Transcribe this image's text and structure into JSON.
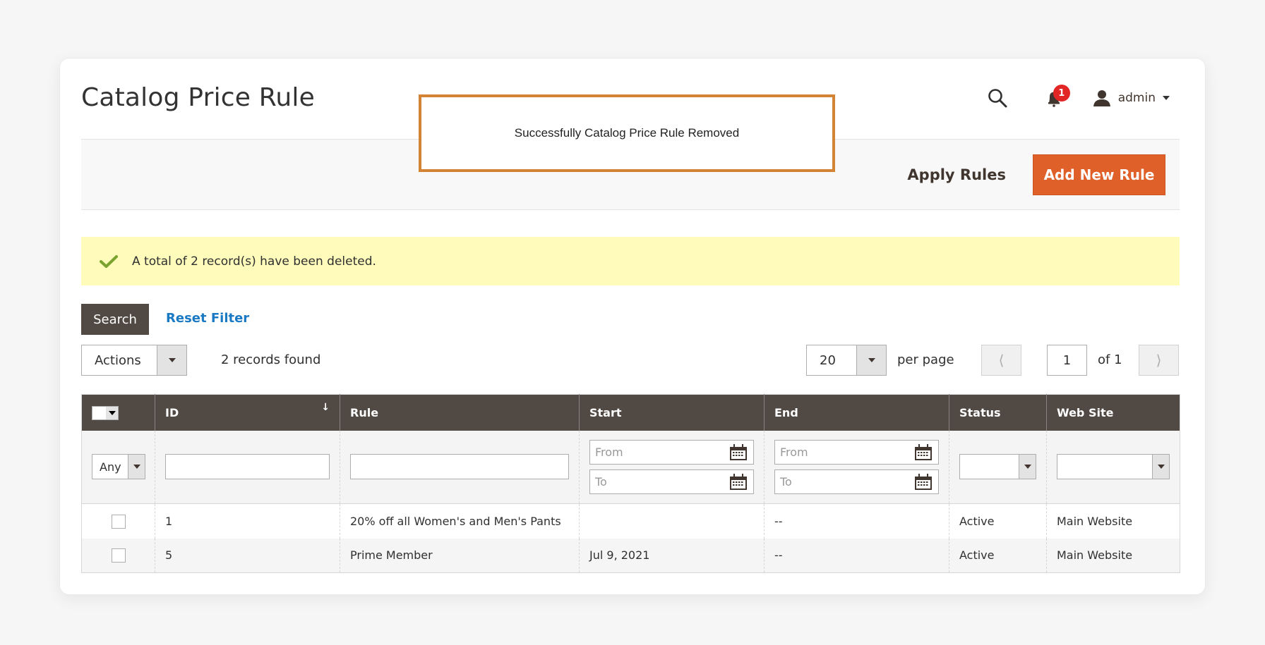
{
  "header": {
    "title": "Catalog Price Rule",
    "notifications_count": "1",
    "user_label": "admin",
    "icons": {
      "search": "search-icon",
      "notifications": "bell-icon",
      "user": "user-icon"
    }
  },
  "toast": {
    "message": "Successfully Catalog Price Rule Removed",
    "border_color": "#d38334"
  },
  "page_actions": {
    "apply_rules_label": "Apply Rules",
    "add_new_rule_label": "Add New Rule",
    "accent_color": "#e0602a"
  },
  "message": {
    "text": "A total of 2 record(s) have been deleted.",
    "icon": "check-icon",
    "background": "#fffbbb"
  },
  "toolbar": {
    "search_label": "Search",
    "reset_filter_label": "Reset Filter",
    "actions_label": "Actions",
    "records_found": "2 records found",
    "per_page_value": "20",
    "per_page_label": "per page",
    "current_page": "1",
    "page_of": "of 1"
  },
  "grid": {
    "columns": [
      {
        "key": "select",
        "label": ""
      },
      {
        "key": "id",
        "label": "ID",
        "sorted": "descending"
      },
      {
        "key": "rule",
        "label": "Rule"
      },
      {
        "key": "start",
        "label": "Start"
      },
      {
        "key": "end",
        "label": "End"
      },
      {
        "key": "status",
        "label": "Status"
      },
      {
        "key": "website",
        "label": "Web Site"
      }
    ],
    "filters": {
      "select_any": "Any",
      "id": "",
      "rule": "",
      "start_from_placeholder": "From",
      "start_to_placeholder": "To",
      "end_from_placeholder": "From",
      "end_to_placeholder": "To",
      "status": "",
      "website": ""
    },
    "rows": [
      {
        "id": "1",
        "rule": "20% off all Women's and Men's Pants",
        "start": "",
        "end": "--",
        "status": "Active",
        "website": "Main Website"
      },
      {
        "id": "5",
        "rule": "Prime Member",
        "start": "Jul 9, 2021",
        "end": "--",
        "status": "Active",
        "website": "Main Website"
      }
    ]
  }
}
